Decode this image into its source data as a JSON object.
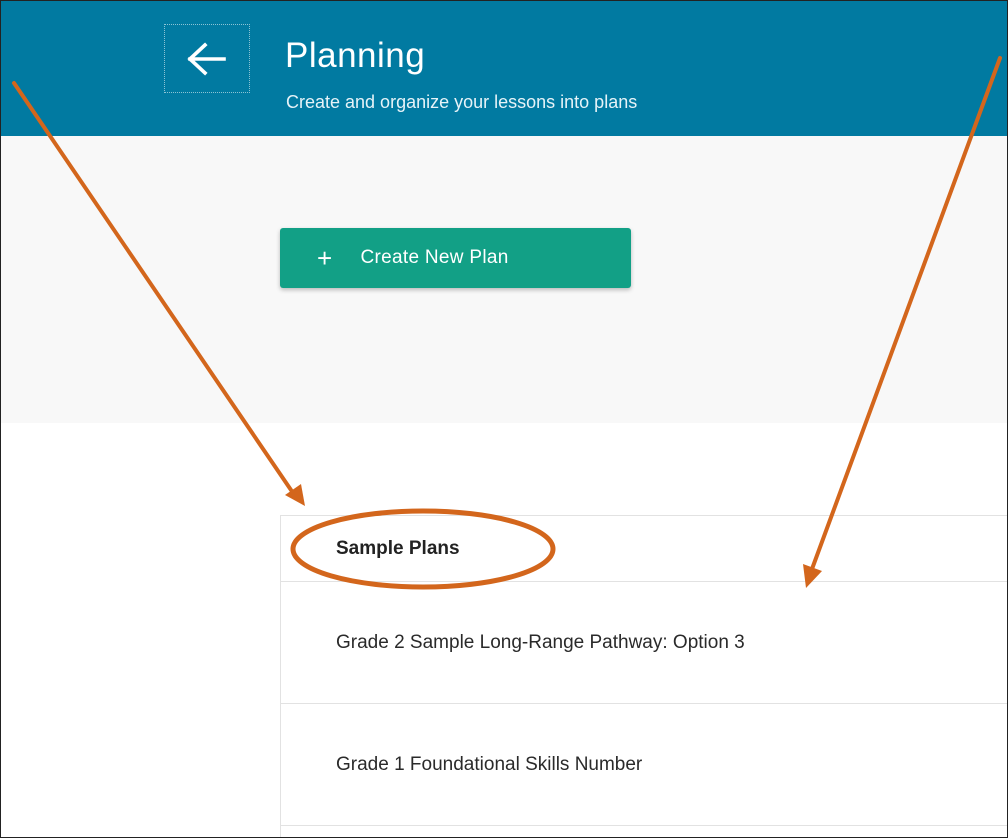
{
  "header": {
    "back_icon": "arrow-left-icon",
    "title": "Planning",
    "subtitle": "Create and organize your lessons into plans"
  },
  "toolbar": {
    "create_icon": "plus-icon",
    "create_label": "Create New Plan"
  },
  "sample_plans": {
    "heading": "Sample Plans",
    "items": [
      {
        "label": "Grade 2 Sample Long-Range Pathway: Option 3"
      },
      {
        "label": "Grade 1 Foundational Skills Number"
      }
    ]
  },
  "colors": {
    "header_bg": "#017aa1",
    "button_bg": "#12a086",
    "toolbar_bg": "#f8f8f8",
    "annotation": "#d3661c"
  }
}
